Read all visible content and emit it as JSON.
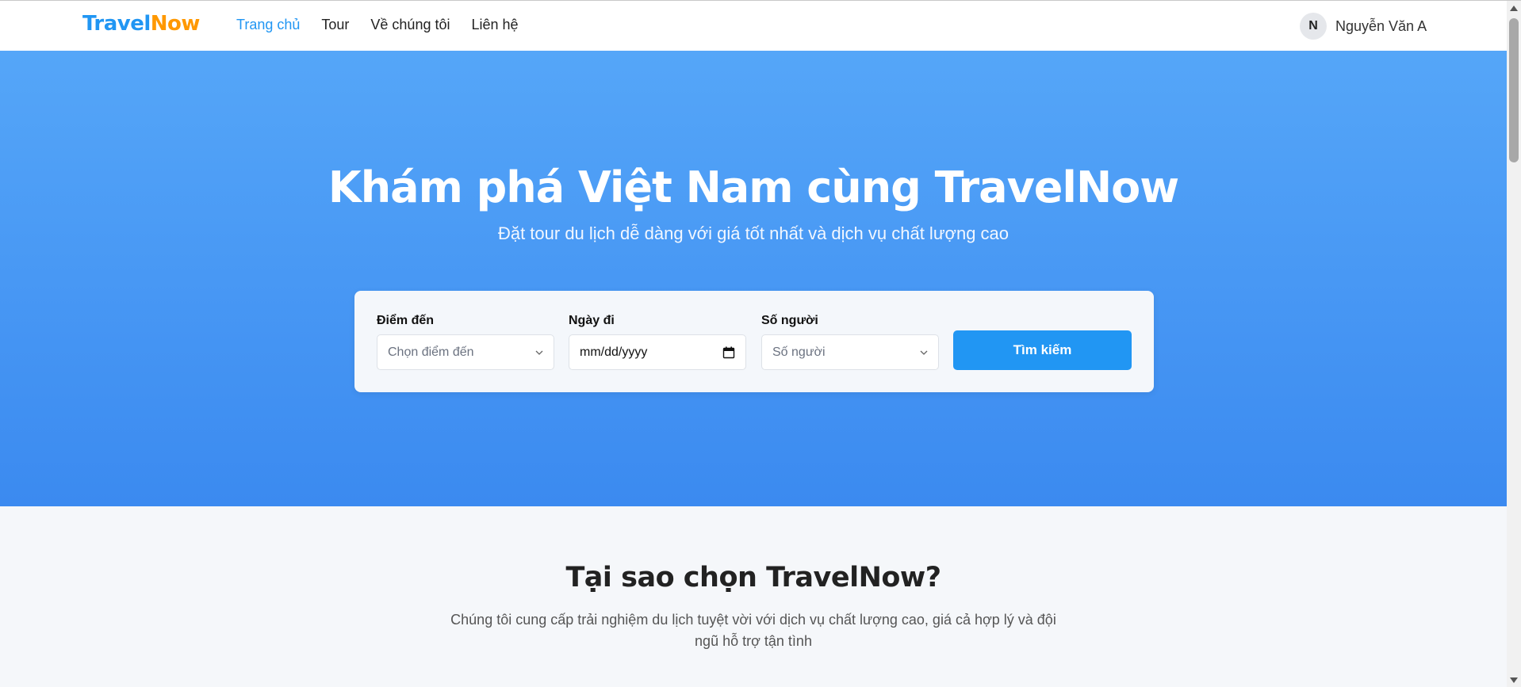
{
  "brand": {
    "part_a": "Travel",
    "part_b": "Now",
    "color_a": "#2196f3",
    "color_b": "#ff9800"
  },
  "nav": {
    "items": [
      {
        "label": "Trang chủ",
        "active": true
      },
      {
        "label": "Tour",
        "active": false
      },
      {
        "label": "Về chúng tôi",
        "active": false
      },
      {
        "label": "Liên hệ",
        "active": false
      }
    ]
  },
  "user": {
    "initial": "N",
    "name": "Nguyễn Văn A"
  },
  "hero": {
    "title": "Khám phá Việt Nam cùng TravelNow",
    "subtitle": "Đặt tour du lịch dễ dàng với giá tốt nhất và dịch vụ chất lượng cao",
    "gradient_top": "#55a6f8",
    "gradient_bottom": "#3b8af0"
  },
  "search": {
    "destination": {
      "label": "Điểm đến",
      "placeholder": "Chọn điểm đến",
      "icon": "chevron-down-icon"
    },
    "date": {
      "label": "Ngày đi",
      "value": "mm/dd/yyyy",
      "icon": "calendar-icon"
    },
    "people": {
      "label": "Số người",
      "placeholder": "Số người",
      "icon": "chevron-down-icon"
    },
    "button_label": "Tìm kiếm",
    "button_color": "#2196f3"
  },
  "why": {
    "title": "Tại sao chọn TravelNow?",
    "description": "Chúng tôi cung cấp trải nghiệm du lịch tuyệt vời với dịch vụ chất lượng cao, giá cả hợp lý và đội ngũ hỗ trợ tận tình"
  }
}
